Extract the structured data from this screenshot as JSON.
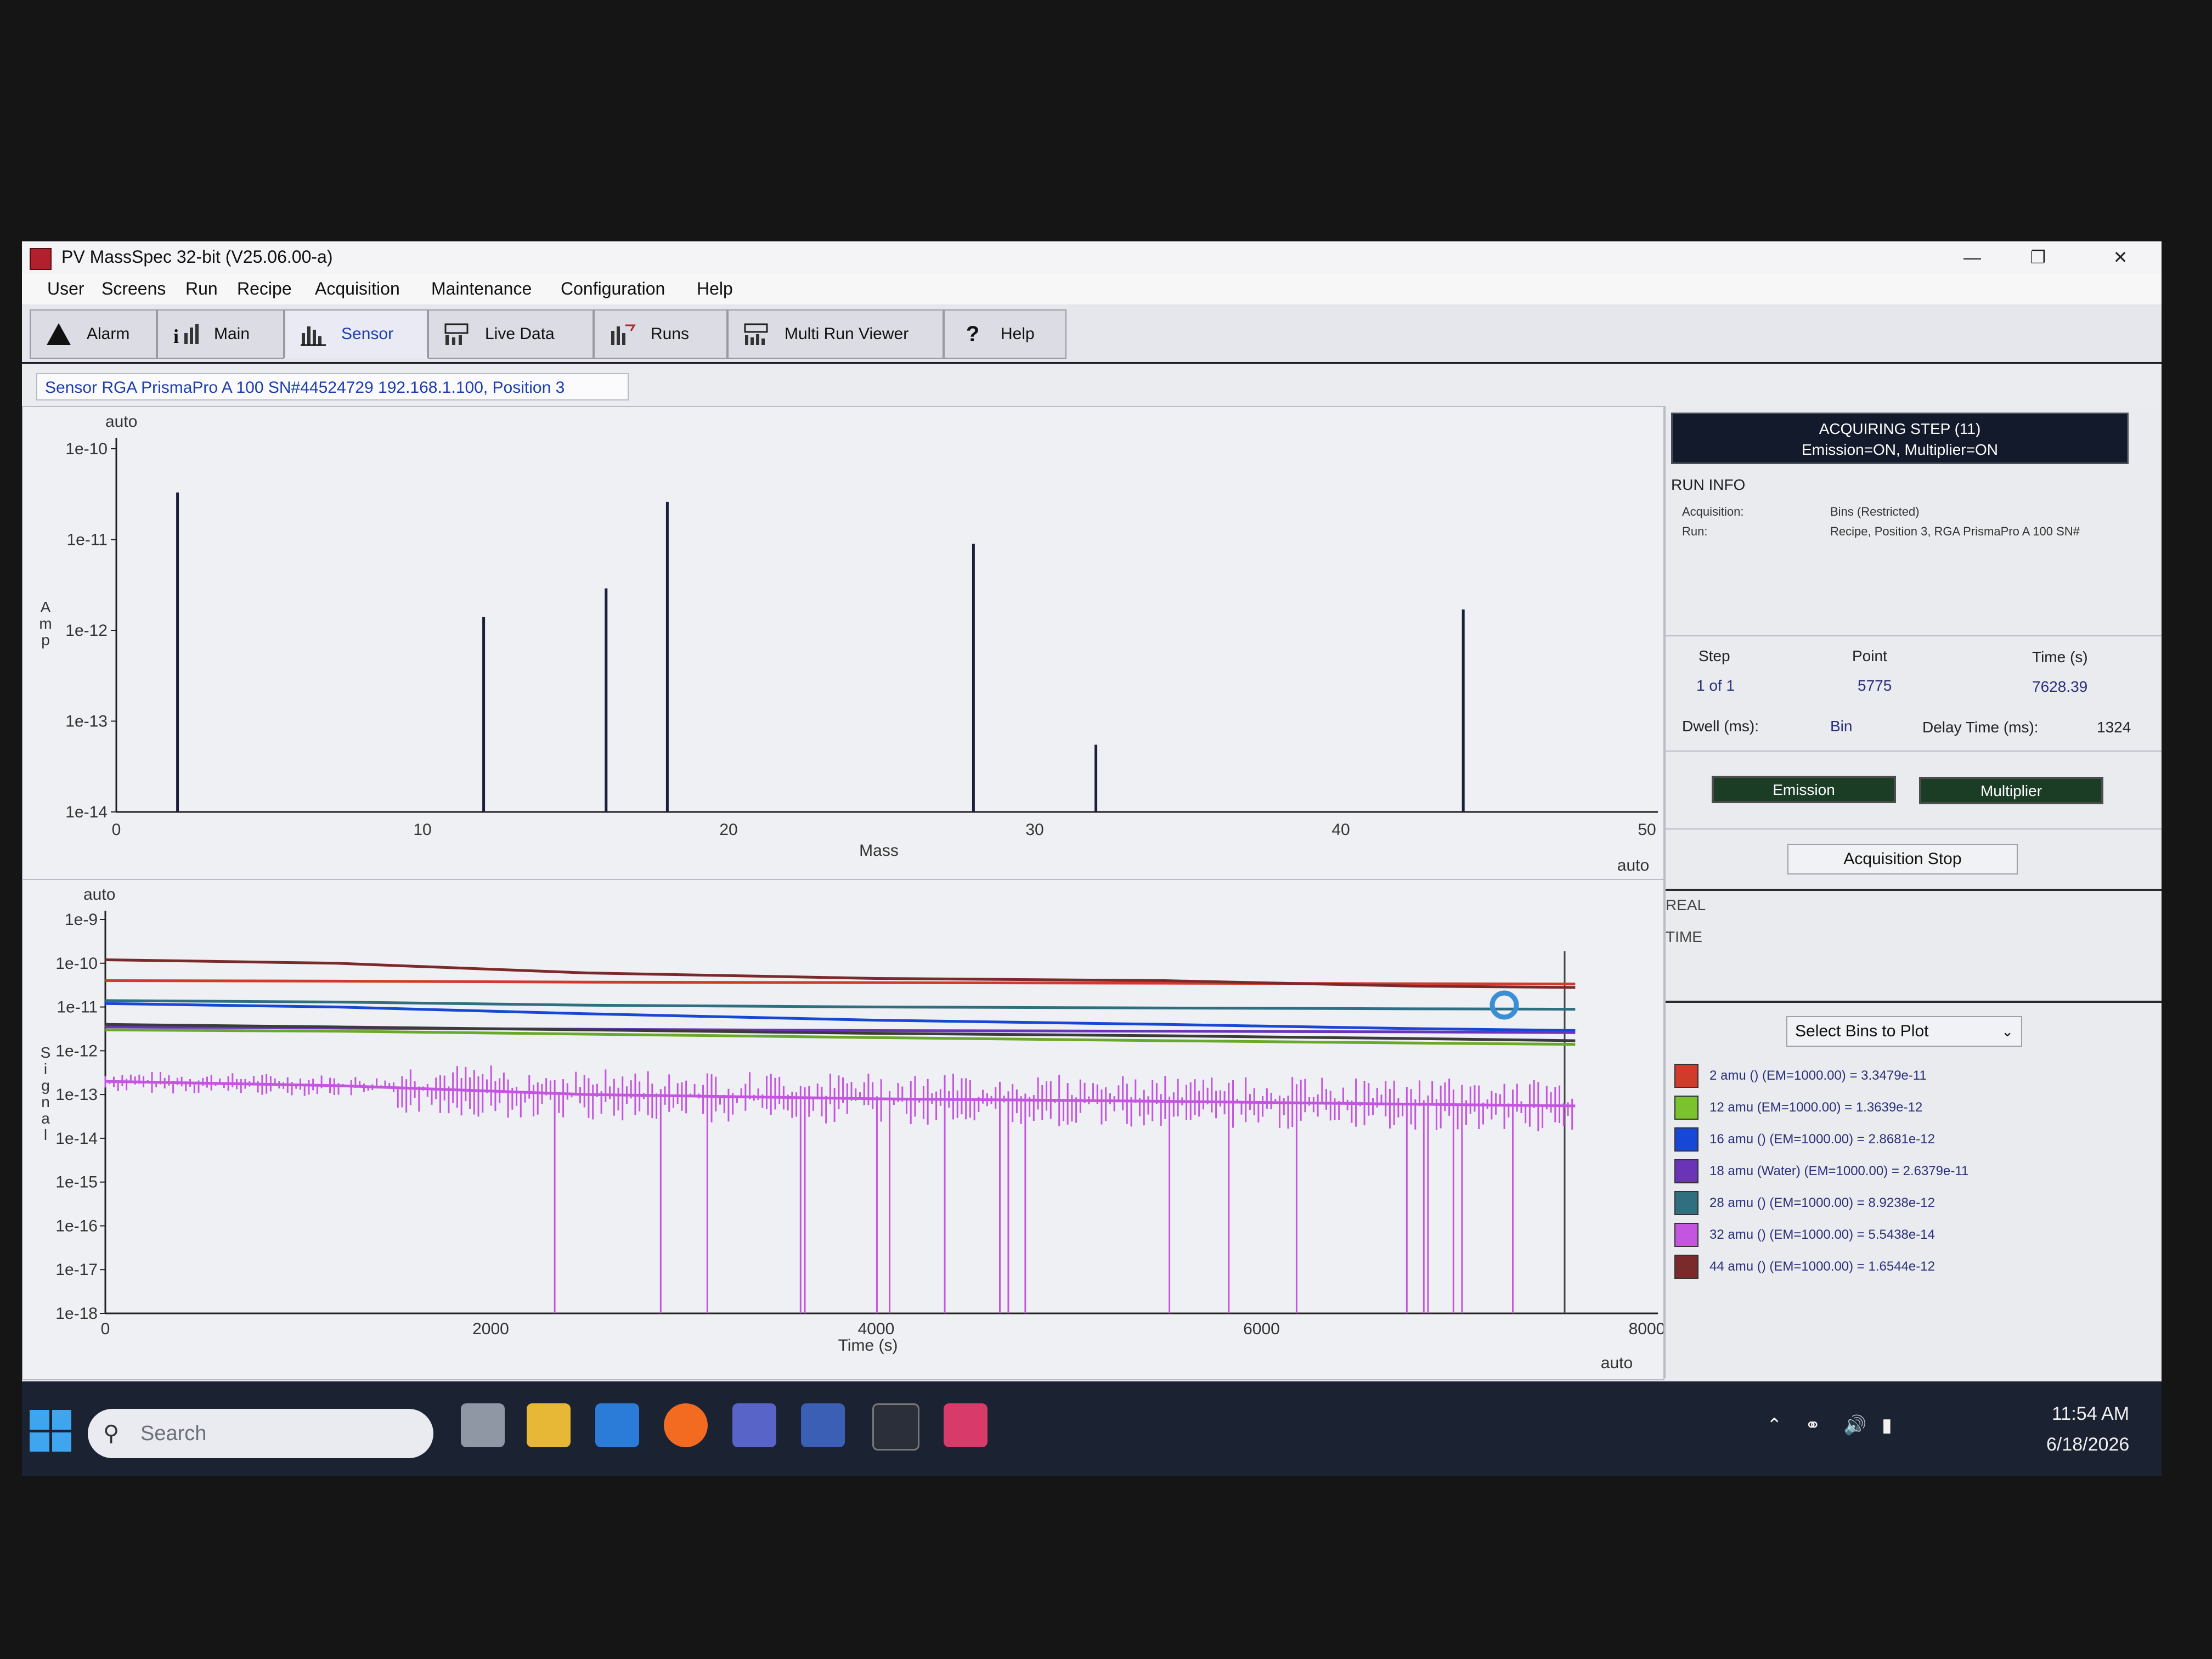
{
  "window": {
    "title": "PV MassSpec 32-bit  (V25.06.00-a)",
    "controls": [
      "—",
      "❐",
      "✕"
    ]
  },
  "menu": [
    "User",
    "Screens",
    "Run",
    "Recipe",
    "Acquisition",
    "Maintenance",
    "Configuration",
    "Help"
  ],
  "toolbar": [
    "Alarm",
    "Main",
    "Sensor",
    "Live Data",
    "Runs",
    "Multi Run Viewer",
    "Help"
  ],
  "sensor_label": "Sensor RGA PrismaPro A 100 SN#44524729 192.168.1.100, Position 3",
  "chart_data": [
    {
      "type": "bar",
      "auto_label": "auto",
      "xlabel": "Mass",
      "ylabel": "Amp",
      "y_scale": "log",
      "x_ticks": [
        "0",
        "10",
        "20",
        "30",
        "40",
        "50"
      ],
      "x_auto": "auto",
      "y_ticks": [
        "1e-10",
        "1e-11",
        "1e-12",
        "1e-13",
        "1e-14"
      ],
      "xlim": [
        0,
        50
      ],
      "ylim": [
        1e-14,
        1e-10
      ],
      "bars": [
        {
          "x": 2,
          "y": 3.3e-11
        },
        {
          "x": 12,
          "y": 1.4e-12
        },
        {
          "x": 16,
          "y": 2.9e-12
        },
        {
          "x": 18,
          "y": 2.6e-11
        },
        {
          "x": 28,
          "y": 9e-12
        },
        {
          "x": 32,
          "y": 5.5e-14
        },
        {
          "x": 44,
          "y": 1.7e-12
        }
      ]
    },
    {
      "type": "line",
      "auto_label": "auto",
      "xlabel": "Time (s)",
      "ylabel": "Signal",
      "y_scale": "log",
      "x_ticks": [
        "0",
        "2000",
        "4000",
        "6000",
        "8000"
      ],
      "x_auto": "auto",
      "y_ticks": [
        "1e-9",
        "1e-10",
        "1e-11",
        "1e-12",
        "1e-13",
        "1e-14",
        "1e-15",
        "1e-16",
        "1e-17",
        "1e-18"
      ],
      "xlim": [
        0,
        8000
      ],
      "ylim": [
        1e-18,
        1e-09
      ],
      "x": [
        0,
        1200,
        2500,
        4000,
        5500,
        6800,
        7628
      ],
      "series": [
        {
          "color": "#d23b2c",
          "values": [
            4e-11,
            3.9e-11,
            3.7e-11,
            3.6e-11,
            3.5e-11,
            3.4e-11,
            3.35e-11
          ]
        },
        {
          "color": "#7a2a2a",
          "values": [
            1.2e-10,
            1e-10,
            6e-11,
            4.5e-11,
            4e-11,
            3e-11,
            2.8e-11
          ]
        },
        {
          "color": "#2f6f7f",
          "values": [
            1.4e-11,
            1.3e-11,
            1.1e-11,
            1e-11,
            9.5e-12,
            9.1e-12,
            8.9e-12
          ]
        },
        {
          "color": "#1747d6",
          "values": [
            1.2e-11,
            1e-11,
            7e-12,
            5e-12,
            4e-12,
            3.2e-12,
            2.9e-12
          ]
        },
        {
          "color": "#6b34b8",
          "values": [
            3.5e-12,
            3.3e-12,
            3.1e-12,
            2.9e-12,
            2.8e-12,
            2.7e-12,
            2.6e-12
          ]
        },
        {
          "color": "#3b3b3b",
          "values": [
            4e-12,
            3.5e-12,
            3e-12,
            2.5e-12,
            2.2e-12,
            1.9e-12,
            1.7e-12
          ]
        },
        {
          "color": "#6aa82a",
          "values": [
            3e-12,
            2.8e-12,
            2.4e-12,
            2e-12,
            1.7e-12,
            1.5e-12,
            1.4e-12
          ]
        },
        {
          "color": "#c455e0",
          "values": [
            2e-13,
            1.6e-13,
            1e-13,
            8e-14,
            7e-14,
            6e-14,
            5.5e-14
          ]
        }
      ]
    }
  ],
  "side": {
    "status_line1": "ACQUIRING STEP (11)",
    "status_line2": "Emission=ON, Multiplier=ON",
    "run_info": "RUN  INFO",
    "acq_label": "Acquisition:",
    "acq_value": "Bins (Restricted)",
    "run_label": "Run:",
    "run_value": "Recipe, Position 3, RGA PrismaPro A 100 SN#",
    "step_h": "Step",
    "point_h": "Point",
    "time_h": "Time (s)",
    "step_v": "1 of 1",
    "point_v": "5775",
    "time_v": "7628.39",
    "dwell_l": "Dwell (ms):",
    "dwell_v": "Bin",
    "delay_l": "Delay Time (ms):",
    "delay_v": "1324",
    "emission": "Emission",
    "multiplier": "Multiplier",
    "acq_stop": "Acquisition Stop",
    "real": "REAL",
    "time": "TIME",
    "select_bins": "Select Bins to Plot",
    "legend": [
      {
        "color": "#d23b2c",
        "label": "2 amu () (EM=1000.00) = 3.3479e-11"
      },
      {
        "color": "#7ac22e",
        "label": "12 amu (EM=1000.00) = 1.3639e-12"
      },
      {
        "color": "#1747d6",
        "label": "16 amu () (EM=1000.00) = 2.8681e-12"
      },
      {
        "color": "#6b34b8",
        "label": "18 amu (Water) (EM=1000.00) = 2.6379e-11"
      },
      {
        "color": "#2f6f7f",
        "label": "28 amu () (EM=1000.00) = 8.9238e-12"
      },
      {
        "color": "#c455e0",
        "label": "32 amu () (EM=1000.00) = 5.5438e-14"
      },
      {
        "color": "#7a2a2a",
        "label": "44 amu () (EM=1000.00) = 1.6544e-12"
      }
    ]
  },
  "taskbar": {
    "search_placeholder": "Search",
    "time": "11:54 AM",
    "date": "6/18/2026"
  }
}
